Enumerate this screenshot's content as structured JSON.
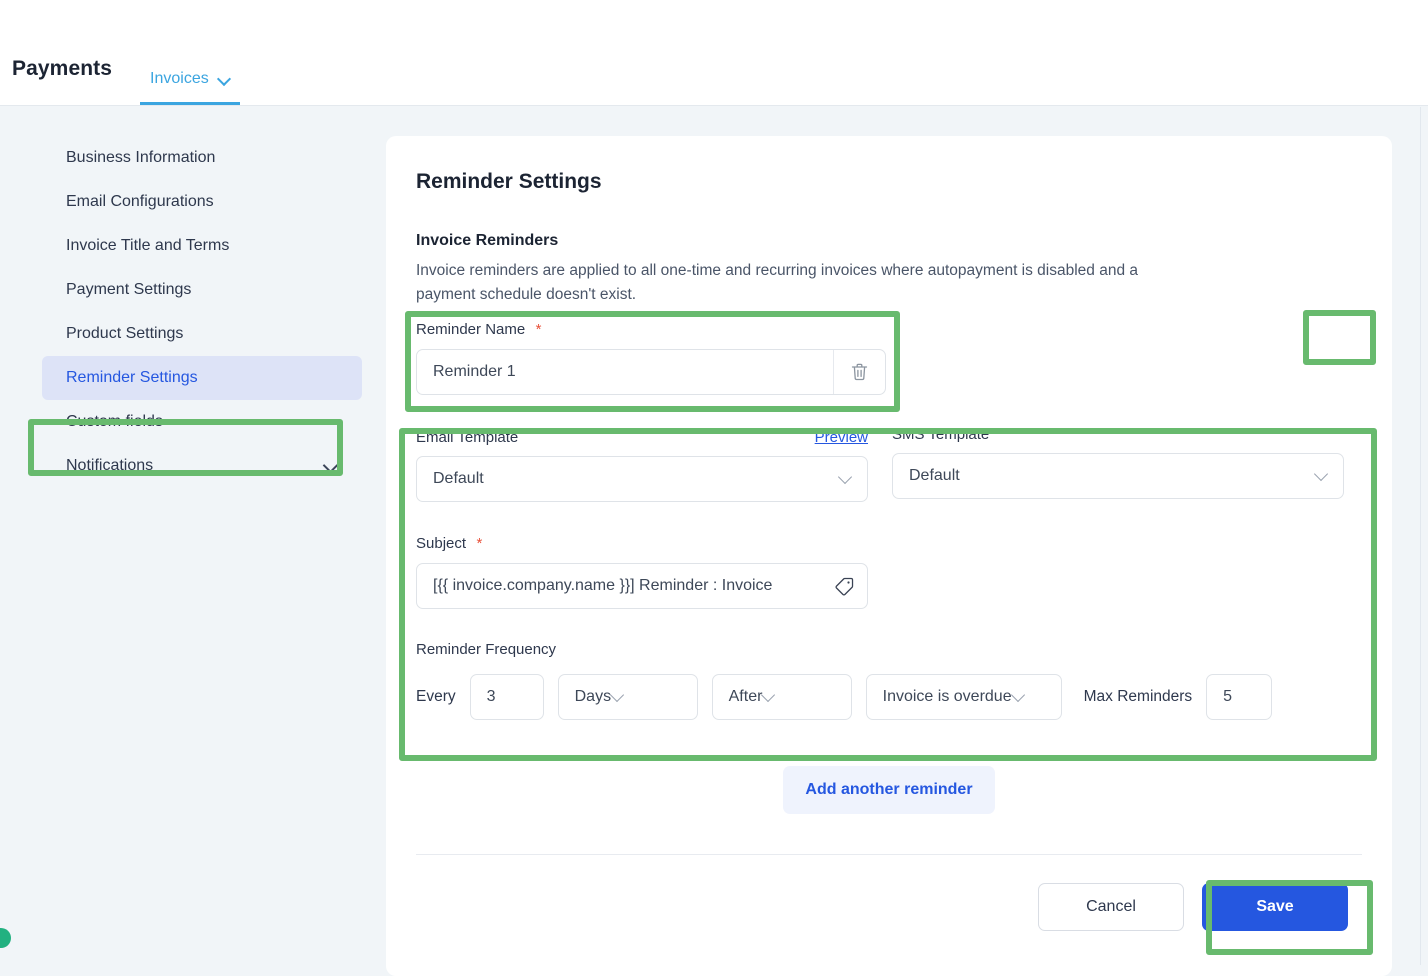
{
  "header": {
    "brand": "Payments",
    "tabs": [
      {
        "label": "Invoices",
        "icon": "chevron-down-icon",
        "active": true
      }
    ]
  },
  "sidebar": {
    "items": [
      {
        "label": "Business Information",
        "active": false
      },
      {
        "label": "Email Configurations",
        "active": false
      },
      {
        "label": "Invoice Title and Terms",
        "active": false
      },
      {
        "label": "Payment Settings",
        "active": false
      },
      {
        "label": "Product Settings",
        "active": false
      },
      {
        "label": "Reminder Settings",
        "active": true
      },
      {
        "label": "Custom fields",
        "active": false
      },
      {
        "label": "Notifications",
        "active": false,
        "icon": "chevron-down-icon"
      }
    ]
  },
  "main": {
    "title": "Reminder Settings",
    "section_title": "Invoice Reminders",
    "section_desc": "Invoice reminders are applied to all one-time and recurring invoices where autopayment is disabled and a payment schedule doesn't exist.",
    "reminder_name": {
      "label": "Reminder Name",
      "required_marker": "*",
      "value": "Reminder 1",
      "delete_icon": "trash-icon"
    },
    "enabled_toggle": {
      "state": "on"
    },
    "email_template": {
      "label": "Email Template",
      "preview_link": "Preview",
      "value": "Default"
    },
    "sms_template": {
      "label": "SMS Template",
      "value": "Default"
    },
    "subject": {
      "label": "Subject",
      "required_marker": "*",
      "value": "[{{ invoice.company.name }}] Reminder : Invoice",
      "tag_icon": "tag-icon"
    },
    "frequency": {
      "label": "Reminder Frequency",
      "every_label": "Every",
      "interval_value": "3",
      "unit_value": "Days",
      "relation_value": "After",
      "event_value": "Invoice is overdue",
      "max_label": "Max Reminders",
      "max_value": "5"
    },
    "add_button": "Add another reminder",
    "cancel_button": "Cancel",
    "save_button": "Save"
  },
  "colors": {
    "accent_blue": "#2557e0",
    "tab_blue": "#3ba5e0",
    "highlight_green": "#68ba6e",
    "sidebar_active_bg": "#dde3f7",
    "required_red": "#e8513a",
    "page_bg": "#f1f5f8"
  }
}
